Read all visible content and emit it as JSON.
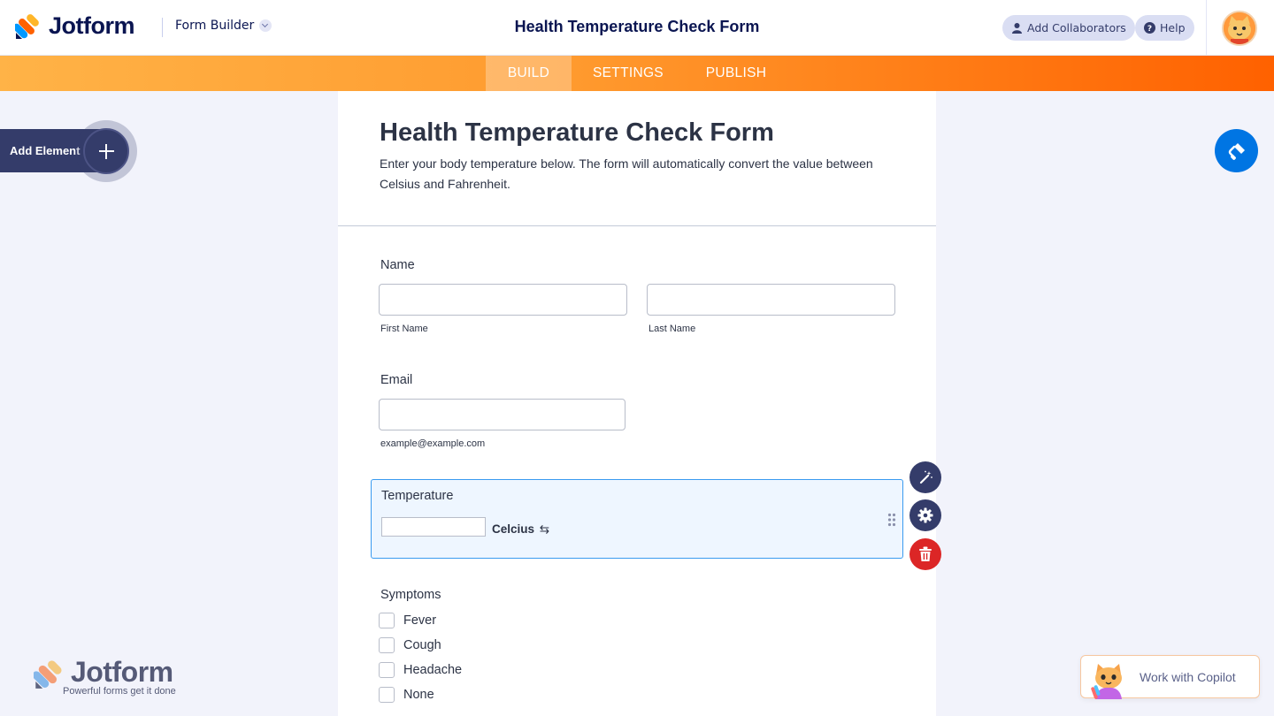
{
  "app": {
    "brand": "Jotform",
    "mode_dropdown": "Form Builder",
    "form_title": "Health Temperature Check Form",
    "add_collaborators": "Add Collaborators",
    "help": "Help"
  },
  "nav": {
    "tabs": [
      {
        "label": "BUILD",
        "active": true
      },
      {
        "label": "SETTINGS",
        "active": false
      },
      {
        "label": "PUBLISH",
        "active": false
      }
    ]
  },
  "sidebar": {
    "add_element": "Add Element"
  },
  "form": {
    "heading": "Health Temperature Check Form",
    "subheading": "Enter your body temperature below. The form will automatically convert the value between Celsius and Fahrenheit.",
    "fields": {
      "name": {
        "label": "Name",
        "first_sub": "First Name",
        "last_sub": "Last Name",
        "first_value": "",
        "last_value": ""
      },
      "email": {
        "label": "Email",
        "value": "",
        "sublabel": "example@example.com"
      },
      "temperature": {
        "label": "Temperature",
        "value": "",
        "unit": "Celcius",
        "swap_icon": "⇆"
      },
      "symptoms": {
        "label": "Symptoms",
        "options": [
          "Fever",
          "Cough",
          "Headache",
          "None"
        ]
      }
    }
  },
  "footer": {
    "watermark_brand": "Jotform",
    "watermark_tagline": "Powerful forms get it done",
    "copilot": "Work with Copilot"
  },
  "colors": {
    "accent_blue": "#0075e3",
    "navy": "#343c6a",
    "orange_start": "#ffb347",
    "orange_end": "#ff6100",
    "danger": "#dc2626"
  }
}
